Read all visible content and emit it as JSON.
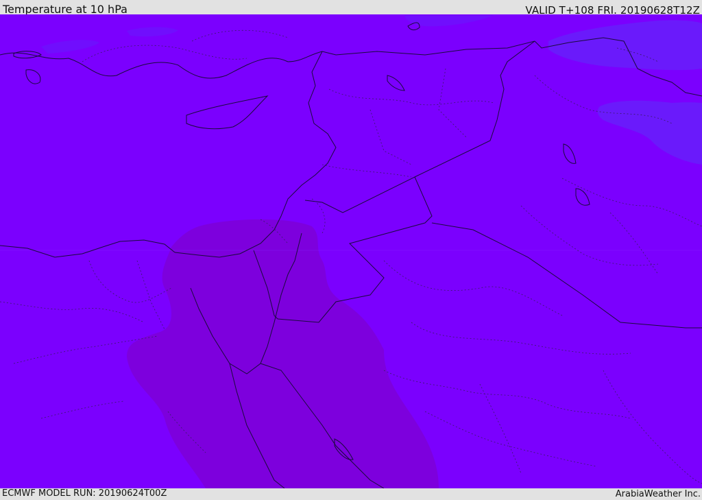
{
  "header": {
    "title": "Temperature at 10 hPa",
    "valid": "VALID T+108 FRI. 20190628T12Z"
  },
  "footer": {
    "model_run": "ECMWF MODEL RUN: 20190624T00Z",
    "credit": "ArabiaWeather Inc."
  },
  "map": {
    "field": "temperature",
    "level": "10 hPa",
    "colors": {
      "base_fill": "#7b00fe",
      "warm_zone": "#7d00dd",
      "cool_zone": "#6a1afb",
      "coast_line": "#1a0a3c",
      "border_dotted": "#3a1a66"
    }
  }
}
